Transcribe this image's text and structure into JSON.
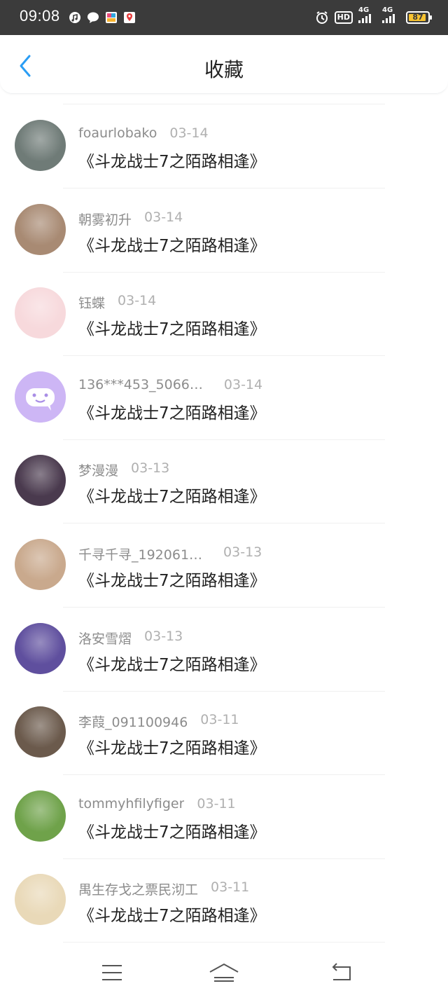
{
  "status_bar": {
    "time": "09:08",
    "hd_label": "HD",
    "network_1": "4G",
    "network_2": "4G",
    "battery": "87",
    "icons": [
      "music-note-icon",
      "chat-bubble-icon",
      "app-icon",
      "map-pin-icon",
      "alarm-icon"
    ]
  },
  "header": {
    "title": "收藏",
    "back_icon": "chevron-left-icon"
  },
  "items": [
    {
      "name": "foaurlobako",
      "date": "03-14",
      "title": "《斗龙战士7之陌路相逢》",
      "avatar_color": "#6f7b77"
    },
    {
      "name": "朝雾初升",
      "date": "03-14",
      "title": "《斗龙战士7之陌路相逢》",
      "avatar_color": "#a88a73"
    },
    {
      "name": "钰蝶",
      "date": "03-14",
      "title": "《斗龙战士7之陌路相逢》",
      "avatar_color": "#f7d9dc"
    },
    {
      "name": "136***453_5066…",
      "date": "03-14",
      "title": "《斗龙战士7之陌路相逢》",
      "avatar_color": "#cdb6f5"
    },
    {
      "name": "梦漫漫",
      "date": "03-13",
      "title": "《斗龙战士7之陌路相逢》",
      "avatar_color": "#4a3a4e"
    },
    {
      "name": "千寻千寻_192061…",
      "date": "03-13",
      "title": "《斗龙战士7之陌路相逢》",
      "avatar_color": "#c9a98d"
    },
    {
      "name": "洛安雪熠",
      "date": "03-13",
      "title": "《斗龙战士7之陌路相逢》",
      "avatar_color": "#5f4f9e"
    },
    {
      "name": "李葭_091100946",
      "date": "03-11",
      "title": "《斗龙战士7之陌路相逢》",
      "avatar_color": "#6b5a4c"
    },
    {
      "name": "tommyhfilyfiger",
      "date": "03-11",
      "title": "《斗龙战士7之陌路相逢》",
      "avatar_color": "#6fa24a"
    },
    {
      "name": "禺生存戈之票民沏工",
      "date": "03-11",
      "title": "《斗龙战士7之陌路相逢》",
      "avatar_color": "#e9d9b8"
    }
  ],
  "nav": {
    "menu_icon": "menu-icon",
    "home_icon": "home-icon",
    "back_icon": "back-icon"
  }
}
